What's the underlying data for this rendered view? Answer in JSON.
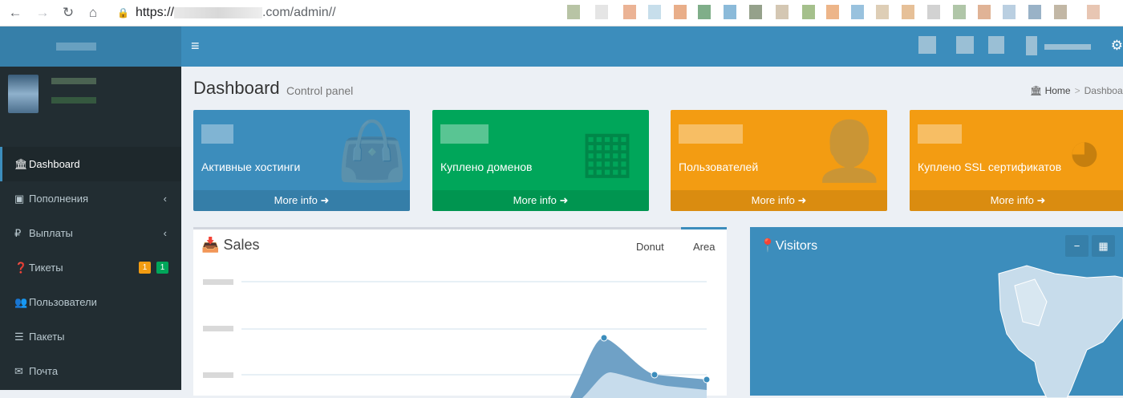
{
  "browser": {
    "url_scheme": "https://",
    "url_path": ".com/admin//"
  },
  "sidebar": {
    "items": [
      {
        "label": "Dashboard",
        "icon": "bank-icon"
      },
      {
        "label": "Пополнения",
        "icon": "money-icon"
      },
      {
        "label": "Выплаты",
        "icon": "ruble-icon"
      },
      {
        "label": "Тикеты",
        "icon": "question-circle-icon",
        "badges": [
          "1",
          "1"
        ]
      },
      {
        "label": "Пользователи",
        "icon": "users-icon"
      },
      {
        "label": "Пакеты",
        "icon": "list-icon"
      },
      {
        "label": "Почта",
        "icon": "envelope-icon"
      }
    ]
  },
  "page": {
    "title": "Dashboard",
    "subtitle": "Control panel",
    "breadcrumb_home": "Home",
    "breadcrumb_current": "Dashboard"
  },
  "stats": [
    {
      "label": "Активные хостинги",
      "more": "More info",
      "color": "#3c8dbc"
    },
    {
      "label": "Куплено доменов",
      "more": "More info",
      "color": "#00a65a"
    },
    {
      "label": "Пользователей",
      "more": "More info",
      "color": "#f39c12"
    },
    {
      "label": "Куплено SSL сертификатов",
      "more": "More info",
      "color": "#f39c12"
    }
  ],
  "sales": {
    "title": "Sales",
    "tabs": [
      "Donut",
      "Area"
    ],
    "active_tab": "Area"
  },
  "visitors": {
    "title": "Visitors"
  },
  "colors": {
    "primary": "#3c8dbc",
    "sidebar_bg": "#222d32",
    "green": "#00a65a",
    "orange": "#f39c12",
    "orange_badge": "#f39c12",
    "green_badge": "#00a65a"
  }
}
